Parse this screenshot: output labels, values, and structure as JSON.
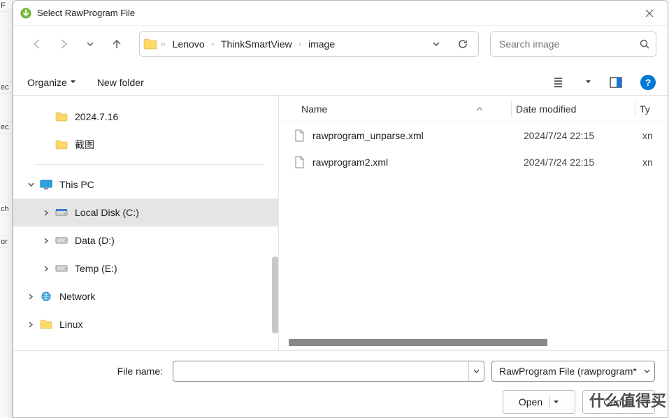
{
  "window": {
    "title": "Select RawProgram File"
  },
  "nav": {
    "crumbs": [
      "Lenovo",
      "ThinkSmartView",
      "image"
    ]
  },
  "search": {
    "placeholder": "Search image"
  },
  "toolbar": {
    "organize": "Organize",
    "new_folder": "New folder"
  },
  "tree": {
    "quick": [
      {
        "label": "2024.7.16"
      },
      {
        "label": "截图"
      }
    ],
    "this_pc": "This PC",
    "drives": [
      {
        "label": "Local Disk (C:)",
        "selected": true
      },
      {
        "label": "Data (D:)"
      },
      {
        "label": "Temp (E:)"
      }
    ],
    "network": "Network",
    "linux": "Linux"
  },
  "columns": {
    "name": "Name",
    "date": "Date modified",
    "type": "Ty"
  },
  "files": [
    {
      "name": "rawprogram_unparse.xml",
      "date": "2024/7/24 22:15",
      "type": "xn"
    },
    {
      "name": "rawprogram2.xml",
      "date": "2024/7/24 22:15",
      "type": "xn"
    }
  ],
  "footer": {
    "filename_label": "File name:",
    "filename_value": "",
    "filter": "RawProgram File (rawprogram*",
    "open": "Open",
    "cancel": "Cancel"
  },
  "watermark": "什么值得买"
}
